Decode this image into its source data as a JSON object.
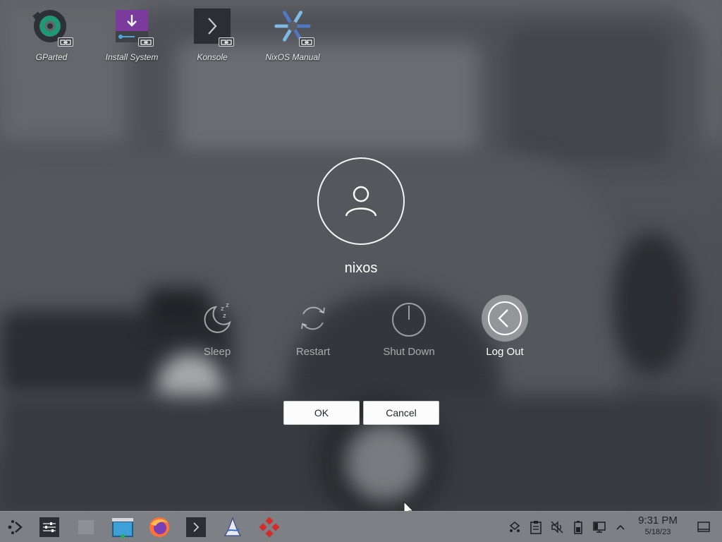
{
  "desktop": {
    "icons": [
      {
        "label": "GParted",
        "icon": "gparted-icon"
      },
      {
        "label": "Install System",
        "icon": "install-system-icon"
      },
      {
        "label": "Konsole",
        "icon": "konsole-icon"
      },
      {
        "label": "NixOS Manual",
        "icon": "nixos-manual-icon"
      }
    ]
  },
  "logout_dialog": {
    "username": "nixos",
    "actions": [
      {
        "label": "Sleep",
        "icon": "sleep-icon",
        "selected": false
      },
      {
        "label": "Restart",
        "icon": "restart-icon",
        "selected": false
      },
      {
        "label": "Shut Down",
        "icon": "shutdown-icon",
        "selected": false
      },
      {
        "label": "Log Out",
        "icon": "logout-icon",
        "selected": true
      }
    ],
    "ok_label": "OK",
    "cancel_label": "Cancel"
  },
  "taskbar": {
    "launcher_icons": [
      "app-launcher-icon",
      "system-settings-icon",
      "blank-task-icon",
      "file-manager-icon",
      "firefox-icon",
      "konsole-icon",
      "calamares-icon",
      "app-icon"
    ],
    "tray_icons": [
      "kde-connect-icon",
      "clipboard-icon",
      "audio-muted-icon",
      "battery-icon",
      "display-icon",
      "expand-tray-icon"
    ],
    "clock": {
      "time": "9:31 PM",
      "date": "5/18/23"
    }
  },
  "colors": {
    "taskbar": "#7d8085",
    "button_bg": "#fcfcfc",
    "selected_action": "#c8cace"
  }
}
